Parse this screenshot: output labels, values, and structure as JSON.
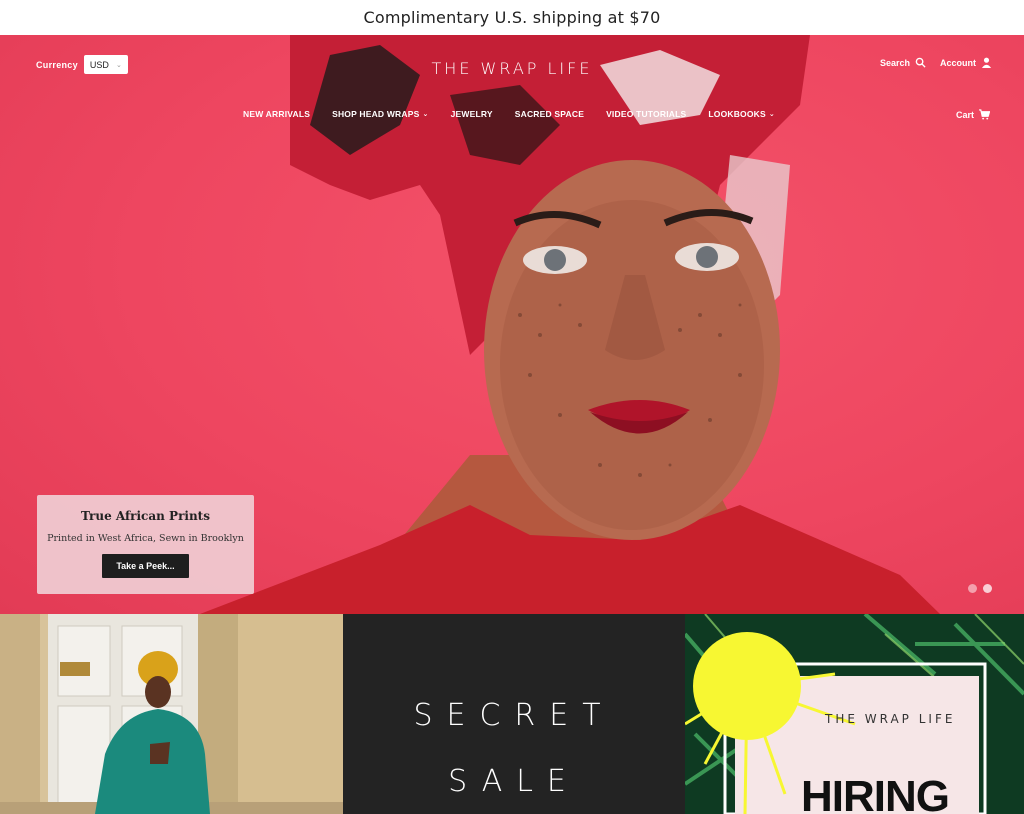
{
  "announcement": {
    "text": "Complimentary U.S. shipping at $70"
  },
  "header": {
    "currency_label": "Currency",
    "currency_value": "USD",
    "logo": "THE WRAP LIFE",
    "search_label": "Search",
    "account_label": "Account",
    "cart_label": "Cart"
  },
  "nav": {
    "items": [
      {
        "label": "NEW ARRIVALS",
        "dropdown": false
      },
      {
        "label": "SHOP HEAD WRAPS",
        "dropdown": true
      },
      {
        "label": "JEWELRY",
        "dropdown": false
      },
      {
        "label": "SACRED SPACE",
        "dropdown": false
      },
      {
        "label": "VIDEO TUTORIALS",
        "dropdown": false
      },
      {
        "label": "LOOKBOOKS",
        "dropdown": true
      }
    ]
  },
  "hero": {
    "title": "True African Prints",
    "subtitle": "Printed in West Africa, Sewn in Brooklyn",
    "button": "Take a Peek...",
    "slides_count": 2,
    "active_slide": 2
  },
  "tiles": {
    "secret_line_1": "SECRET",
    "secret_line_2": "SALE",
    "hiring_logo": "THE WRAP LIFE",
    "hiring_word": "HIRING"
  },
  "colors": {
    "hero_bg": "#ee4660",
    "promo_bg": "#f0cdd4",
    "button_bg": "#1e1e1e",
    "sale_bg": "#232323",
    "sun": "#f7f732"
  }
}
